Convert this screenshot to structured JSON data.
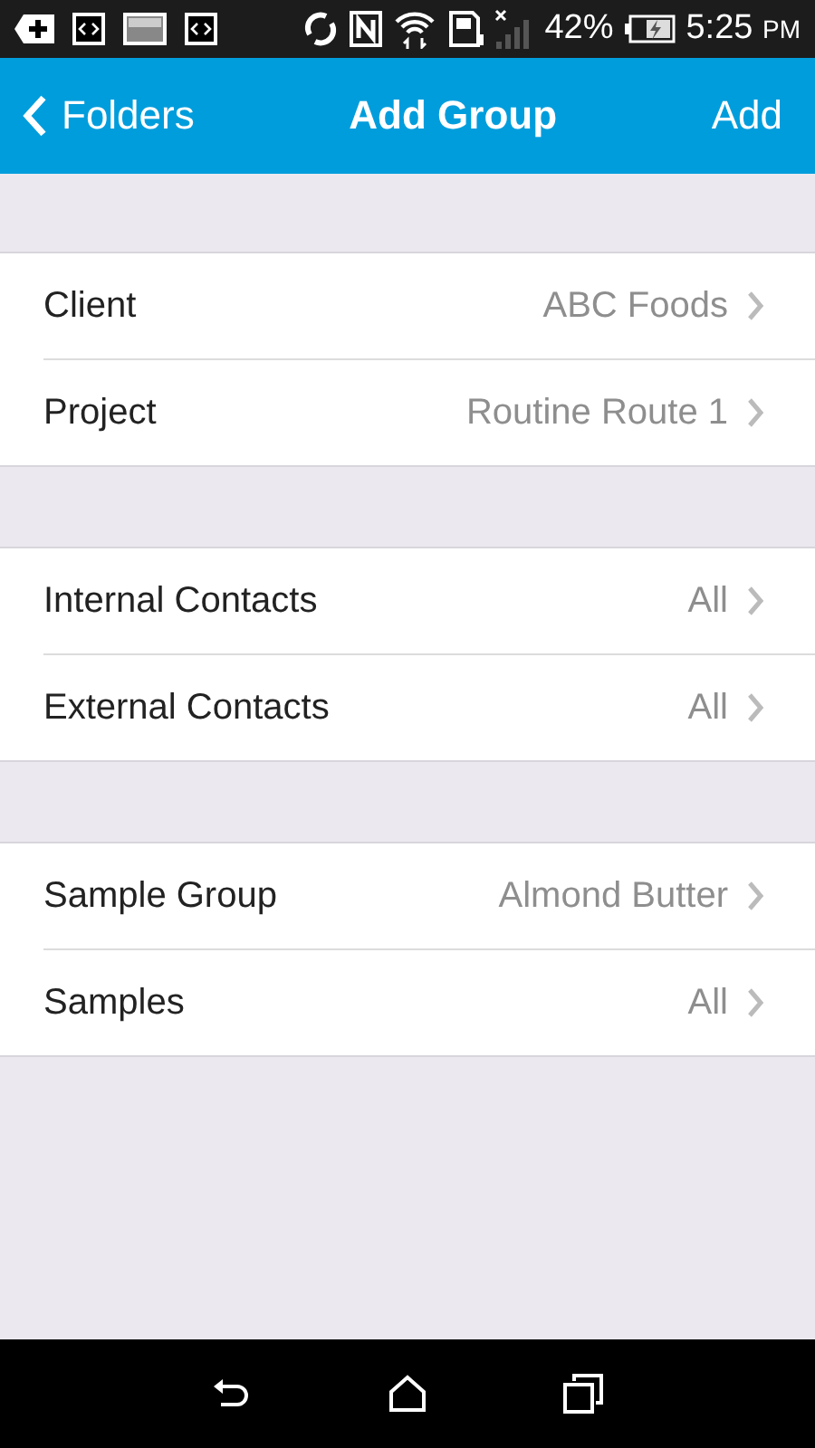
{
  "status_bar": {
    "battery": "42%",
    "time": "5:25",
    "ampm": "PM"
  },
  "nav": {
    "back": "Folders",
    "title": "Add Group",
    "action": "Add"
  },
  "groups": [
    {
      "rows": [
        {
          "label": "Client",
          "value": "ABC Foods"
        },
        {
          "label": "Project",
          "value": "Routine Route 1"
        }
      ]
    },
    {
      "rows": [
        {
          "label": "Internal Contacts",
          "value": "All"
        },
        {
          "label": "External Contacts",
          "value": "All"
        }
      ]
    },
    {
      "rows": [
        {
          "label": "Sample Group",
          "value": "Almond Butter"
        },
        {
          "label": "Samples",
          "value": "All"
        }
      ]
    }
  ]
}
